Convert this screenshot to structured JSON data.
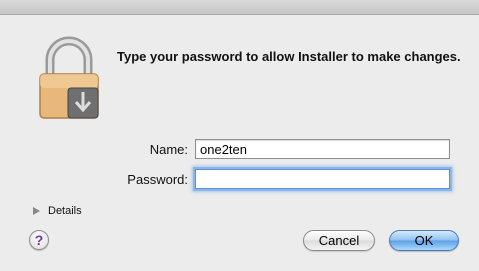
{
  "dialog": {
    "message": "Type your password to allow Installer to make changes."
  },
  "form": {
    "name_label": "Name:",
    "name_value": "one2ten",
    "password_label": "Password:",
    "password_value": ""
  },
  "details_label": "Details",
  "help_label": "?",
  "buttons": {
    "cancel": "Cancel",
    "ok": "OK"
  },
  "colors": {
    "window_bg": "#ececec",
    "default_button": "#5c9fe6",
    "focus_ring": "#8cb6ea",
    "help_mark": "#6a3aa0"
  },
  "icons": {
    "lock": "lock-installer-icon",
    "disclosure": "disclosure-triangle-icon"
  }
}
